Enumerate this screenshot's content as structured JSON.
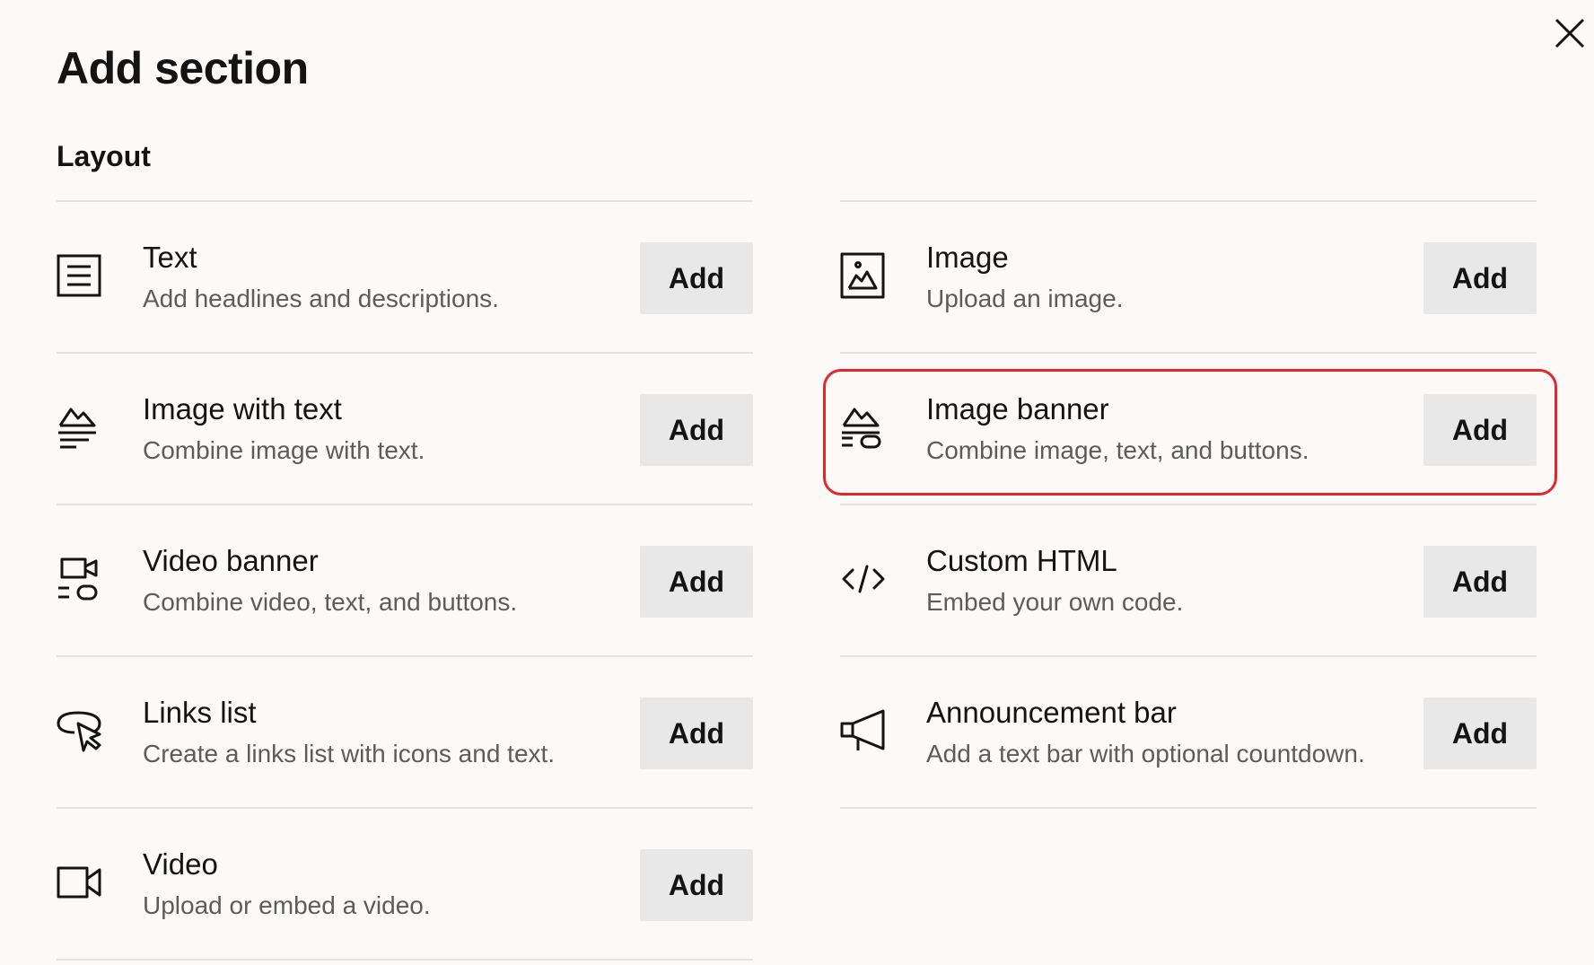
{
  "dialog": {
    "title": "Add section",
    "close_icon": "close-icon"
  },
  "section": {
    "heading": "Layout"
  },
  "left_items": [
    {
      "title": "Text",
      "description": "Add headlines and descriptions.",
      "button": "Add",
      "icon": "text-icon"
    },
    {
      "title": "Image with text",
      "description": "Combine image with text.",
      "button": "Add",
      "icon": "image-with-text-icon"
    },
    {
      "title": "Video banner",
      "description": "Combine video, text, and buttons.",
      "button": "Add",
      "icon": "video-banner-icon"
    },
    {
      "title": "Links list",
      "description": "Create a links list with icons and text.",
      "button": "Add",
      "icon": "links-list-icon"
    },
    {
      "title": "Video",
      "description": "Upload or embed a video.",
      "button": "Add",
      "icon": "video-icon"
    }
  ],
  "right_items": [
    {
      "title": "Image",
      "description": "Upload an image.",
      "button": "Add",
      "icon": "image-icon"
    },
    {
      "title": "Image banner",
      "description": "Combine image, text, and buttons.",
      "button": "Add",
      "icon": "image-banner-icon",
      "highlighted": true
    },
    {
      "title": "Custom HTML",
      "description": "Embed your own code.",
      "button": "Add",
      "icon": "code-icon"
    },
    {
      "title": "Announcement bar",
      "description": "Add a text bar with optional countdown.",
      "button": "Add",
      "icon": "megaphone-icon"
    }
  ],
  "colors": {
    "background": "#fbfaf9",
    "button_bg": "#e8e8e8",
    "highlight": "#e5262b",
    "divider": "#e3e3e3",
    "description_text": "#5c5c5c"
  }
}
